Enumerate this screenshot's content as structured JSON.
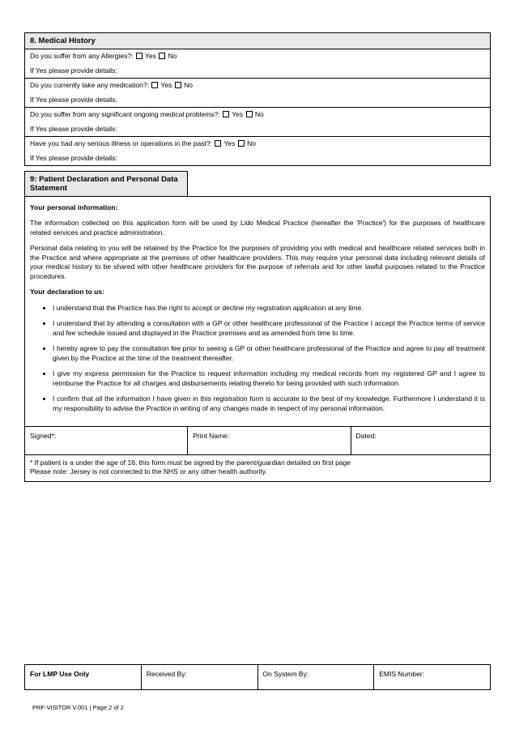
{
  "section8": {
    "title": "8. Medical History",
    "q1": "Do you suffer from any Allergies?:",
    "q2": "Do you currently take any medication?:",
    "q3": "Do you suffer from any significant ongoing medical problems?:",
    "q4": "Have you had any serious illness or operations in the past?:",
    "yes": "Yes",
    "no": "No",
    "details": "If Yes please provide details:"
  },
  "section9": {
    "title": "9: Patient Declaration and Personal Data Statement",
    "info_heading": "Your personal information:",
    "info_p1": "The information collected on this application form will be used by Lido Medical Practice (hereafter the 'Practice') for the purposes of healthcare related services and practice administration.",
    "info_p2": "Personal data relating to you will be retained by the Practice for the purposes of providing you with medical and healthcare related services both in the Practice and where appropriate at the premises of other healthcare providers. This may require your personal data including relevant details of your medical history to be shared with other healthcare providers for the purpose of referrals and for other lawful purposes related to the Practice procedures.",
    "decl_heading": "Your declaration to us:",
    "b1": "I understand that the Practice has the right to accept or decline my registration application at any time.",
    "b2": "I understand that by attending a consultation with a GP or other healthcare professional of the Practice I accept the Practice terms of service and fee schedule issued and displayed in the Practice premises and as amended from time to time.",
    "b3": "I hereby agree to pay the consultation fee prior to seeing a GP or other healthcare professional of the Practice and agree to pay all treatment given by the Practice at the time of the treatment thereafter.",
    "b4": "I give my express permission for the Practice to request information including my medical records from my registered GP and I agree to reimburse the Practice for all charges and disbursements relating thereto for being provided with such information.",
    "b5": "I confirm that all the information I have given in this registration form is accurate to the best of my knowledge. Furthermore I understand it is my responsibility to advise the Practice in writing of any changes made in respect of my personal information.",
    "signed": "Signed*:",
    "print_name": "Print Name:",
    "dated": "Dated:",
    "footnote1": "* If patient is a under the age of 16, this form must be signed by the parent/guardian detailed on first page",
    "footnote2": "Please note: Jersey is not connected to the NHS or any other health authority."
  },
  "lmp": {
    "title": "For LMP Use Only",
    "received": "Received By:",
    "system": "On System By:",
    "emis": "EMIS Number:"
  },
  "footer": "PRF-VISITOR V.001 | Page 2 of 2"
}
